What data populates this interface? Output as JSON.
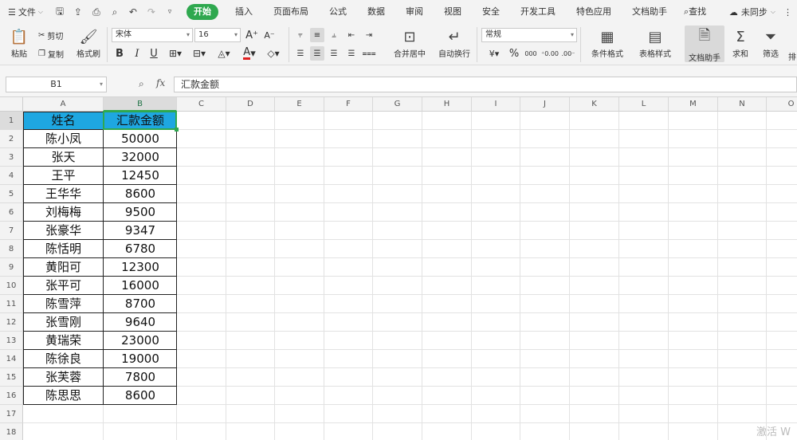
{
  "menu": {
    "file": "文件",
    "tabs": [
      {
        "label": "开始",
        "active": true
      },
      {
        "label": "插入"
      },
      {
        "label": "页面布局"
      },
      {
        "label": "公式"
      },
      {
        "label": "数据"
      },
      {
        "label": "审阅"
      },
      {
        "label": "视图"
      },
      {
        "label": "安全"
      },
      {
        "label": "开发工具"
      },
      {
        "label": "特色应用"
      },
      {
        "label": "文档助手"
      }
    ],
    "search": "查找",
    "sync": "未同步"
  },
  "ribbon": {
    "paste": "粘贴",
    "cut": "剪切",
    "copy": "复制",
    "format_painter": "格式刷",
    "font_name": "宋体",
    "font_size": "16",
    "merge_center": "合并居中",
    "wrap_text": "自动换行",
    "number_format": "常规",
    "conditional_format": "条件格式",
    "table_style": "表格样式",
    "doc_assistant": "文档助手",
    "sum": "求和",
    "filter": "筛选",
    "sort_partial": "排"
  },
  "formula_bar": {
    "name_box": "B1",
    "fx": "fx",
    "content": "汇款金额"
  },
  "columns": [
    "A",
    "B",
    "C",
    "D",
    "E",
    "F",
    "G",
    "H",
    "I",
    "J",
    "K",
    "L",
    "M",
    "N",
    "O"
  ],
  "rows": [
    "1",
    "2",
    "3",
    "4",
    "5",
    "6",
    "7",
    "8",
    "9",
    "10",
    "11",
    "12",
    "13",
    "14",
    "15",
    "16",
    "17",
    "18"
  ],
  "table": {
    "headers": [
      "姓名",
      "汇款金额"
    ],
    "data": [
      [
        "陈小凤",
        "50000"
      ],
      [
        "张天",
        "32000"
      ],
      [
        "王平",
        "12450"
      ],
      [
        "王华华",
        "8600"
      ],
      [
        "刘梅梅",
        "9500"
      ],
      [
        "张豪华",
        "9347"
      ],
      [
        "陈恬明",
        "6780"
      ],
      [
        "黄阳可",
        "12300"
      ],
      [
        "张平可",
        "16000"
      ],
      [
        "陈雪萍",
        "8700"
      ],
      [
        "张雪刚",
        "9640"
      ],
      [
        "黄瑞荣",
        "23000"
      ],
      [
        "陈徐良",
        "19000"
      ],
      [
        "张芙蓉",
        "7800"
      ],
      [
        "陈思思",
        "8600"
      ]
    ]
  },
  "watermark": "激活 W",
  "colors": {
    "accent": "#2fa84f",
    "header_fill": "#1ea7e1"
  }
}
